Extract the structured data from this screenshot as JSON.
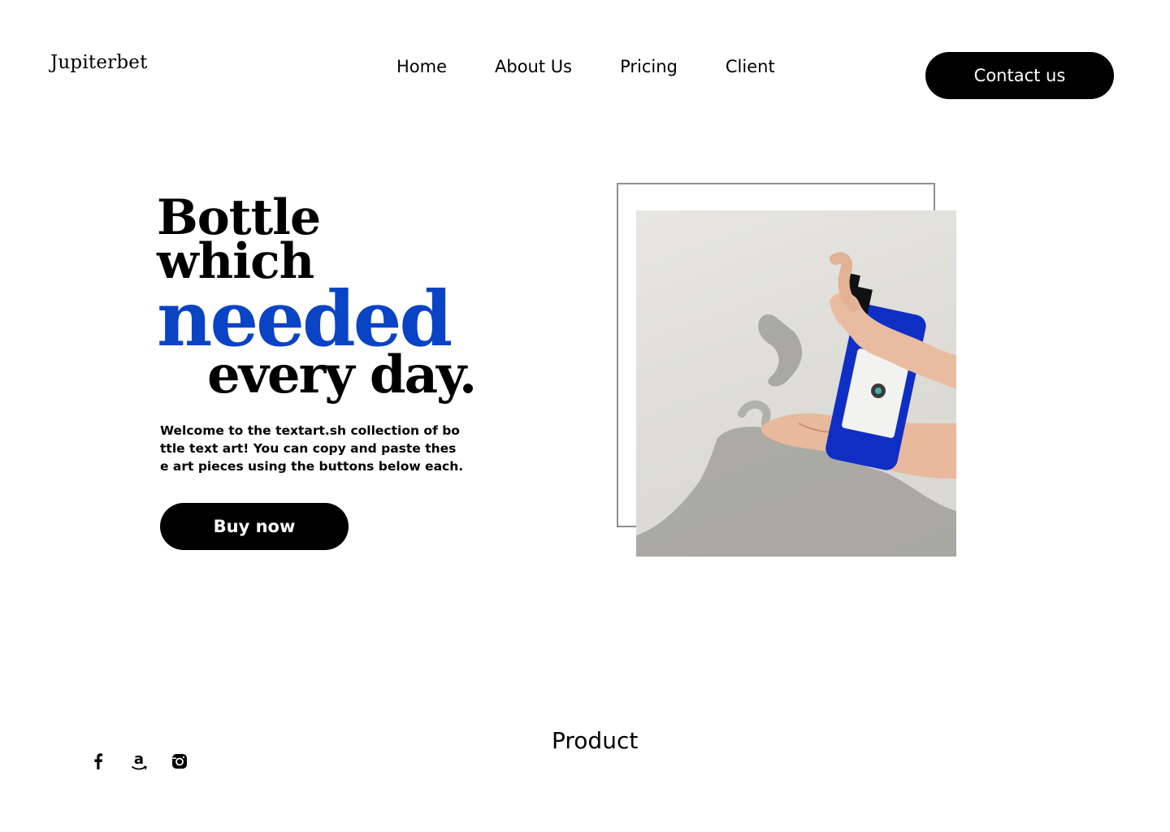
{
  "header": {
    "logo": "Jupiterbet",
    "nav": [
      {
        "label": "Home"
      },
      {
        "label": "About Us"
      },
      {
        "label": "Pricing"
      },
      {
        "label": "Client"
      }
    ],
    "contact_label": "Contact us"
  },
  "hero": {
    "line1": "Bottle",
    "line2": "which",
    "line3": "needed",
    "line4": "every day.",
    "description": "Welcome to the textart.sh collection of bottle text art! You can copy and paste these art pieces using the buttons below each.",
    "buy_label": "Buy now",
    "accent_color": "#0b43c5",
    "image_alt": "hands-pumping-blue-bottle-photo"
  },
  "footer": {
    "social_icons": [
      "facebook-icon",
      "amazon-icon",
      "instagram-icon"
    ],
    "product_heading": "Product"
  }
}
